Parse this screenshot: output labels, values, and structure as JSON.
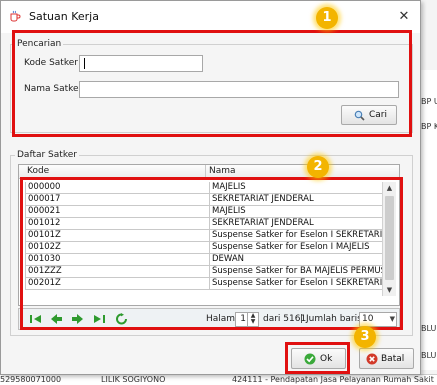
{
  "background": {
    "right_snippets": [
      "BP U",
      "BP K",
      "BLU",
      "BLU"
    ],
    "bottom_row": [
      "529580071000",
      "LILIK SOGIYONO",
      "424111 - Pendapatan Jasa Pelayanan Rumah Sakit"
    ]
  },
  "dialog": {
    "title": "Satuan Kerja",
    "close_glyph": "✕"
  },
  "search": {
    "legend": "Pencarian",
    "kode_label": "Kode Satker",
    "kode_value": "",
    "nama_label": "Nama Satker",
    "nama_value": "",
    "cari_label": "Cari"
  },
  "list": {
    "legend": "Daftar Satker",
    "columns": [
      "Kode",
      "Nama"
    ],
    "rows": [
      {
        "kode": "000000",
        "nama": "MAJELIS"
      },
      {
        "kode": "000017",
        "nama": "SEKRETARIAT JENDERAL"
      },
      {
        "kode": "000021",
        "nama": "MAJELIS"
      },
      {
        "kode": "001012",
        "nama": "SEKRETARIAT JENDERAL"
      },
      {
        "kode": "00101Z",
        "nama": "Suspense Satker for Eselon I SEKRETARI..."
      },
      {
        "kode": "00102Z",
        "nama": "Suspense Satker for Eselon I MAJELIS"
      },
      {
        "kode": "001030",
        "nama": "DEWAN"
      },
      {
        "kode": "001ZZZ",
        "nama": "Suspense Satker for BA MAJELIS PERMUS..."
      },
      {
        "kode": "00201Z",
        "nama": "Suspense Satker for Eselon I SEKRETARI..."
      }
    ]
  },
  "pager": {
    "halaman_label": "Halaman",
    "page_value": "1",
    "dari_text": "dari 5161",
    "jumlah_label": "Jumlah baris",
    "rows_value": "10"
  },
  "actions": {
    "ok_label": "Ok",
    "batal_label": "Batal"
  },
  "annotations": [
    "1",
    "2",
    "3"
  ],
  "colors": {
    "annotation_red": "#e01010",
    "badge_yellow": "#f3b400",
    "nav_green": "#2e9a2e",
    "batal_red": "#d23a2a"
  }
}
